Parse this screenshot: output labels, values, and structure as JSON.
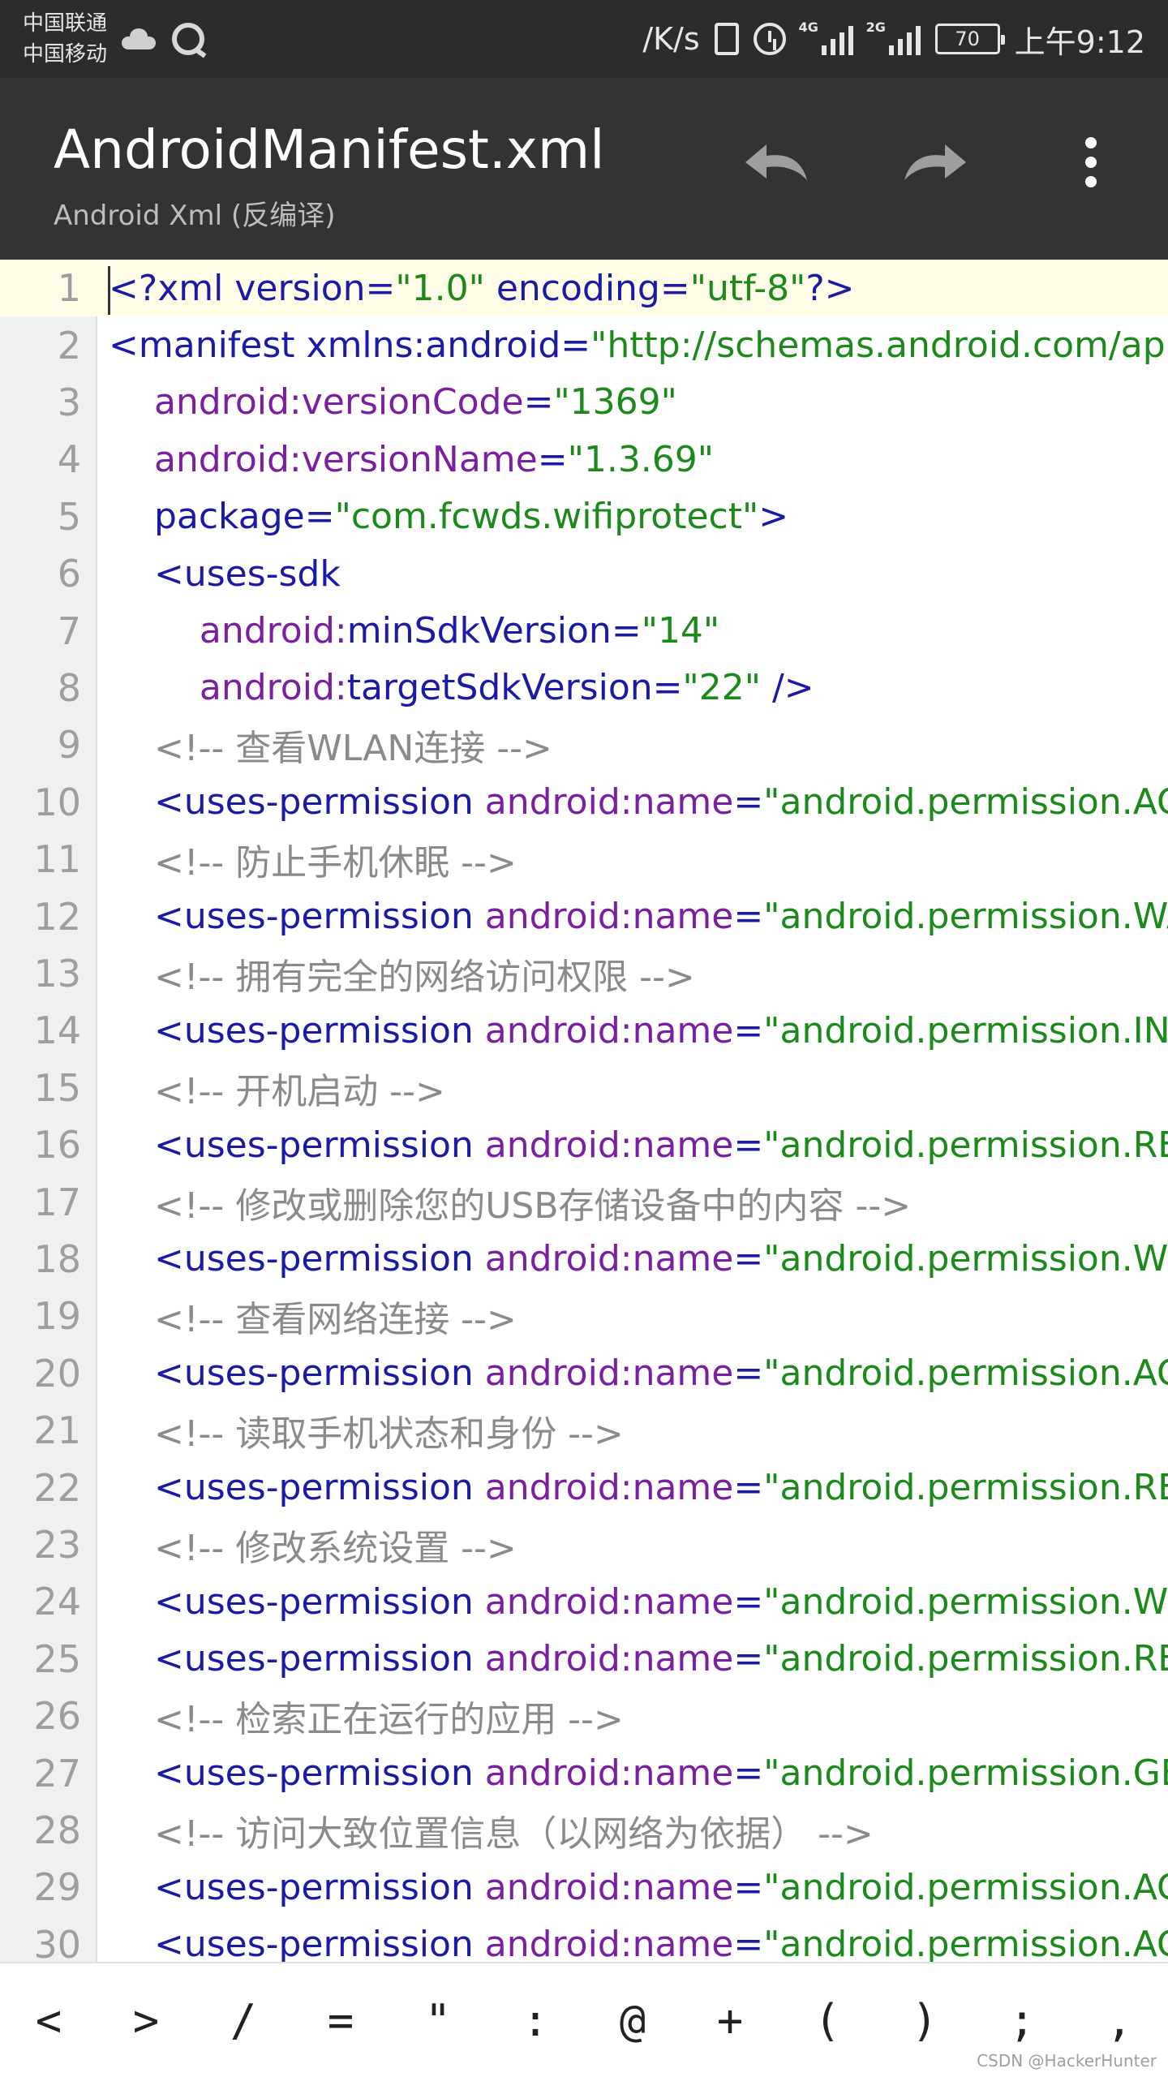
{
  "status_bar": {
    "carrier1": "中国联通",
    "carrier2": "中国移动",
    "speed": "/K/s",
    "signal1_label": "4G",
    "signal2_label": "2G",
    "battery": "70",
    "time": "上午9:12"
  },
  "app_bar": {
    "title": "AndroidManifest.xml",
    "subtitle": "Android Xml (反编译)",
    "undo_icon": "undo-icon",
    "redo_icon": "redo-icon",
    "more_icon": "more-vert-icon"
  },
  "editor": {
    "current_line": 1,
    "lines": [
      {
        "num": "1",
        "indent": "",
        "tokens": [
          {
            "t": "punc",
            "v": "<?xml "
          },
          {
            "t": "tag",
            "v": "version"
          },
          {
            "t": "punc",
            "v": "="
          },
          {
            "t": "val",
            "v": "\"1.0\""
          },
          {
            "t": "tag",
            "v": " encoding"
          },
          {
            "t": "punc",
            "v": "="
          },
          {
            "t": "val",
            "v": "\"utf-8\""
          },
          {
            "t": "punc",
            "v": "?>"
          }
        ]
      },
      {
        "num": "2",
        "indent": "",
        "tokens": [
          {
            "t": "tag",
            "v": "<manifest "
          },
          {
            "t": "tag",
            "v": "xmlns:android"
          },
          {
            "t": "punc",
            "v": "="
          },
          {
            "t": "val",
            "v": "\"http://schemas.android.com/apk"
          }
        ]
      },
      {
        "num": "3",
        "indent": "    ",
        "tokens": [
          {
            "t": "attr",
            "v": "android:versionCode"
          },
          {
            "t": "punc",
            "v": "="
          },
          {
            "t": "val",
            "v": "\"1369\""
          }
        ]
      },
      {
        "num": "4",
        "indent": "    ",
        "tokens": [
          {
            "t": "attr",
            "v": "android:versionName"
          },
          {
            "t": "punc",
            "v": "="
          },
          {
            "t": "val",
            "v": "\"1.3.69\""
          }
        ]
      },
      {
        "num": "5",
        "indent": "    ",
        "tokens": [
          {
            "t": "tag",
            "v": "package"
          },
          {
            "t": "punc",
            "v": "="
          },
          {
            "t": "val",
            "v": "\"com.fcwds.wifiprotect\""
          },
          {
            "t": "punc",
            "v": ">"
          }
        ]
      },
      {
        "num": "6",
        "indent": "    ",
        "tokens": [
          {
            "t": "tag",
            "v": "<uses-sdk"
          }
        ]
      },
      {
        "num": "7",
        "indent": "        ",
        "tokens": [
          {
            "t": "attr",
            "v": "android:"
          },
          {
            "t": "tag",
            "v": "minSdkVersion"
          },
          {
            "t": "punc",
            "v": "="
          },
          {
            "t": "val",
            "v": "\"14\""
          }
        ]
      },
      {
        "num": "8",
        "indent": "        ",
        "tokens": [
          {
            "t": "attr",
            "v": "android:"
          },
          {
            "t": "tag",
            "v": "targetSdkVersion"
          },
          {
            "t": "punc",
            "v": "="
          },
          {
            "t": "val",
            "v": "\"22\""
          },
          {
            "t": "punc",
            "v": " />"
          }
        ]
      },
      {
        "num": "9",
        "indent": "    ",
        "tokens": [
          {
            "t": "cmt",
            "v": "<!-- 查看WLAN连接 -->"
          }
        ]
      },
      {
        "num": "10",
        "indent": "    ",
        "tokens": [
          {
            "t": "tag",
            "v": "<uses-permission "
          },
          {
            "t": "attr",
            "v": "android:name"
          },
          {
            "t": "punc",
            "v": "="
          },
          {
            "t": "val",
            "v": "\"android.permission.ACC"
          }
        ]
      },
      {
        "num": "11",
        "indent": "    ",
        "tokens": [
          {
            "t": "cmt",
            "v": "<!-- 防止手机休眠 -->"
          }
        ]
      },
      {
        "num": "12",
        "indent": "    ",
        "tokens": [
          {
            "t": "tag",
            "v": "<uses-permission "
          },
          {
            "t": "attr",
            "v": "android:name"
          },
          {
            "t": "punc",
            "v": "="
          },
          {
            "t": "val",
            "v": "\"android.permission.WAK"
          }
        ]
      },
      {
        "num": "13",
        "indent": "    ",
        "tokens": [
          {
            "t": "cmt",
            "v": "<!-- 拥有完全的网络访问权限 -->"
          }
        ]
      },
      {
        "num": "14",
        "indent": "    ",
        "tokens": [
          {
            "t": "tag",
            "v": "<uses-permission "
          },
          {
            "t": "attr",
            "v": "android:name"
          },
          {
            "t": "punc",
            "v": "="
          },
          {
            "t": "val",
            "v": "\"android.permission.INT"
          }
        ]
      },
      {
        "num": "15",
        "indent": "    ",
        "tokens": [
          {
            "t": "cmt",
            "v": "<!-- 开机启动 -->"
          }
        ]
      },
      {
        "num": "16",
        "indent": "    ",
        "tokens": [
          {
            "t": "tag",
            "v": "<uses-permission "
          },
          {
            "t": "attr",
            "v": "android:name"
          },
          {
            "t": "punc",
            "v": "="
          },
          {
            "t": "val",
            "v": "\"android.permission.REC"
          }
        ]
      },
      {
        "num": "17",
        "indent": "    ",
        "tokens": [
          {
            "t": "cmt",
            "v": "<!-- 修改或删除您的USB存储设备中的内容 -->"
          }
        ]
      },
      {
        "num": "18",
        "indent": "    ",
        "tokens": [
          {
            "t": "tag",
            "v": "<uses-permission "
          },
          {
            "t": "attr",
            "v": "android:name"
          },
          {
            "t": "punc",
            "v": "="
          },
          {
            "t": "val",
            "v": "\"android.permission.WRI"
          }
        ]
      },
      {
        "num": "19",
        "indent": "    ",
        "tokens": [
          {
            "t": "cmt",
            "v": "<!-- 查看网络连接 -->"
          }
        ]
      },
      {
        "num": "20",
        "indent": "    ",
        "tokens": [
          {
            "t": "tag",
            "v": "<uses-permission "
          },
          {
            "t": "attr",
            "v": "android:name"
          },
          {
            "t": "punc",
            "v": "="
          },
          {
            "t": "val",
            "v": "\"android.permission.ACC"
          }
        ]
      },
      {
        "num": "21",
        "indent": "    ",
        "tokens": [
          {
            "t": "cmt",
            "v": "<!-- 读取手机状态和身份 -->"
          }
        ]
      },
      {
        "num": "22",
        "indent": "    ",
        "tokens": [
          {
            "t": "tag",
            "v": "<uses-permission "
          },
          {
            "t": "attr",
            "v": "android:name"
          },
          {
            "t": "punc",
            "v": "="
          },
          {
            "t": "val",
            "v": "\"android.permission.REA"
          }
        ]
      },
      {
        "num": "23",
        "indent": "    ",
        "tokens": [
          {
            "t": "cmt",
            "v": "<!-- 修改系统设置 -->"
          }
        ]
      },
      {
        "num": "24",
        "indent": "    ",
        "tokens": [
          {
            "t": "tag",
            "v": "<uses-permission "
          },
          {
            "t": "attr",
            "v": "android:name"
          },
          {
            "t": "punc",
            "v": "="
          },
          {
            "t": "val",
            "v": "\"android.permission.WRI"
          }
        ]
      },
      {
        "num": "25",
        "indent": "    ",
        "tokens": [
          {
            "t": "tag",
            "v": "<uses-permission "
          },
          {
            "t": "attr",
            "v": "android:name"
          },
          {
            "t": "punc",
            "v": "="
          },
          {
            "t": "val",
            "v": "\"android.permission.REA"
          }
        ]
      },
      {
        "num": "26",
        "indent": "    ",
        "tokens": [
          {
            "t": "cmt",
            "v": "<!-- 检索正在运行的应用 -->"
          }
        ]
      },
      {
        "num": "27",
        "indent": "    ",
        "tokens": [
          {
            "t": "tag",
            "v": "<uses-permission "
          },
          {
            "t": "attr",
            "v": "android:name"
          },
          {
            "t": "punc",
            "v": "="
          },
          {
            "t": "val",
            "v": "\"android.permission.GET"
          }
        ]
      },
      {
        "num": "28",
        "indent": "    ",
        "tokens": [
          {
            "t": "cmt",
            "v": "<!-- 访问大致位置信息（以网络为依据） -->"
          }
        ]
      },
      {
        "num": "29",
        "indent": "    ",
        "tokens": [
          {
            "t": "tag",
            "v": "<uses-permission "
          },
          {
            "t": "attr",
            "v": "android:name"
          },
          {
            "t": "punc",
            "v": "="
          },
          {
            "t": "val",
            "v": "\"android.permission.ACC"
          }
        ]
      },
      {
        "num": "30",
        "indent": "    ",
        "tokens": [
          {
            "t": "tag",
            "v": "<uses-permission "
          },
          {
            "t": "attr",
            "v": "android:name"
          },
          {
            "t": "punc",
            "v": "="
          },
          {
            "t": "val",
            "v": "\"android.permission.ACC"
          }
        ]
      }
    ]
  },
  "symbol_bar": {
    "keys": [
      "<",
      ">",
      "/",
      "=",
      "\"",
      ":",
      "@",
      "+",
      "(",
      ")",
      ";",
      ","
    ]
  },
  "watermark": "CSDN @HackerHunter",
  "colors": {
    "tag": "#1a1aa6",
    "attr": "#7b1fa2",
    "value": "#1b8a1b",
    "comment": "#8a8a8a",
    "appbar": "#333333",
    "statusbar": "#2c2c2c"
  }
}
